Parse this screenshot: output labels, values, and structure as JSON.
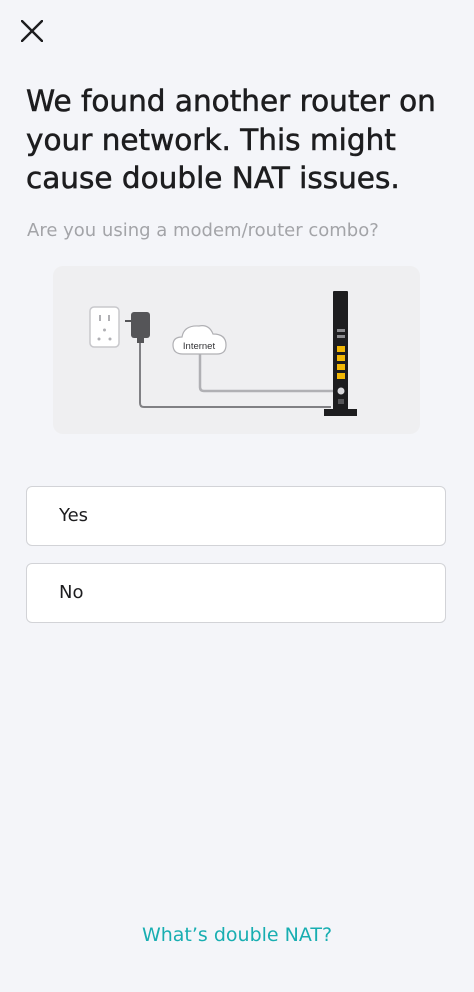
{
  "header": {
    "close_icon": "close-icon"
  },
  "content": {
    "title": "We found another router on your network. This might cause double NAT issues.",
    "question": "Are you using a modem/router combo?",
    "illustration": {
      "cloud_label": "Internet",
      "icons": [
        "wall-outlet-icon",
        "power-adapter-icon",
        "cloud-icon",
        "modem-router-icon"
      ],
      "port_color": "#f2b705"
    },
    "options": [
      {
        "label": "Yes"
      },
      {
        "label": "No"
      }
    ]
  },
  "footer": {
    "help_link": "What’s double NAT?"
  },
  "colors": {
    "accent": "#18aeb1",
    "background": "#f4f5f9",
    "card_border": "#d2d3d7"
  }
}
